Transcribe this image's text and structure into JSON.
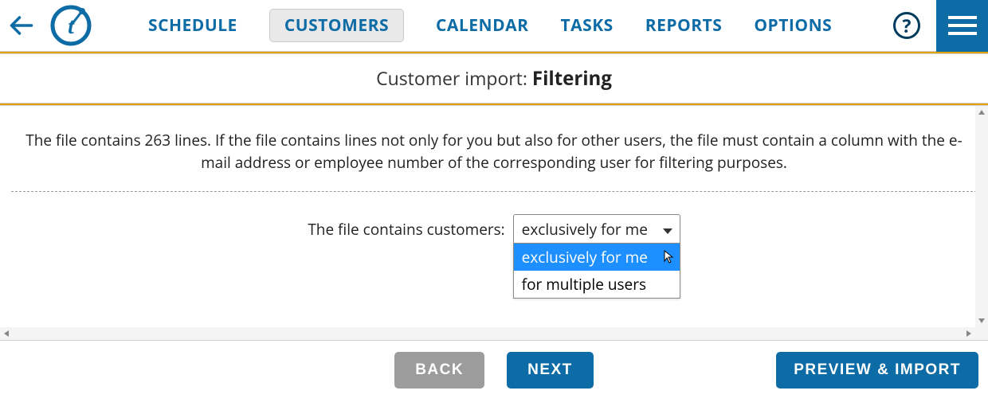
{
  "header": {
    "nav": {
      "schedule": "SCHEDULE",
      "customers": "CUSTOMERS",
      "calendar": "CALENDAR",
      "tasks": "TASKS",
      "reports": "REPORTS",
      "options": "OPTIONS"
    },
    "help_glyph": "?"
  },
  "title": {
    "prefix": "Customer import: ",
    "bold": "Filtering"
  },
  "main": {
    "intro": "The file contains 263 lines. If the file contains lines not only for you but also for other users, the file must contain a column with the e-mail address or employee number of the corresponding user for filtering purposes.",
    "label": "The file contains customers:",
    "select": {
      "selected": "exclusively for me",
      "options": {
        "exclusively": "exclusively for me",
        "multiple": "for multiple users"
      }
    }
  },
  "footer": {
    "back": "BACK",
    "next": "NEXT",
    "preview": "PREVIEW & IMPORT"
  },
  "colors": {
    "brand_blue": "#0d6ca6",
    "dark_navy": "#003a5c",
    "accent_orange": "#e2a300",
    "highlight_blue": "#1e8fff"
  }
}
